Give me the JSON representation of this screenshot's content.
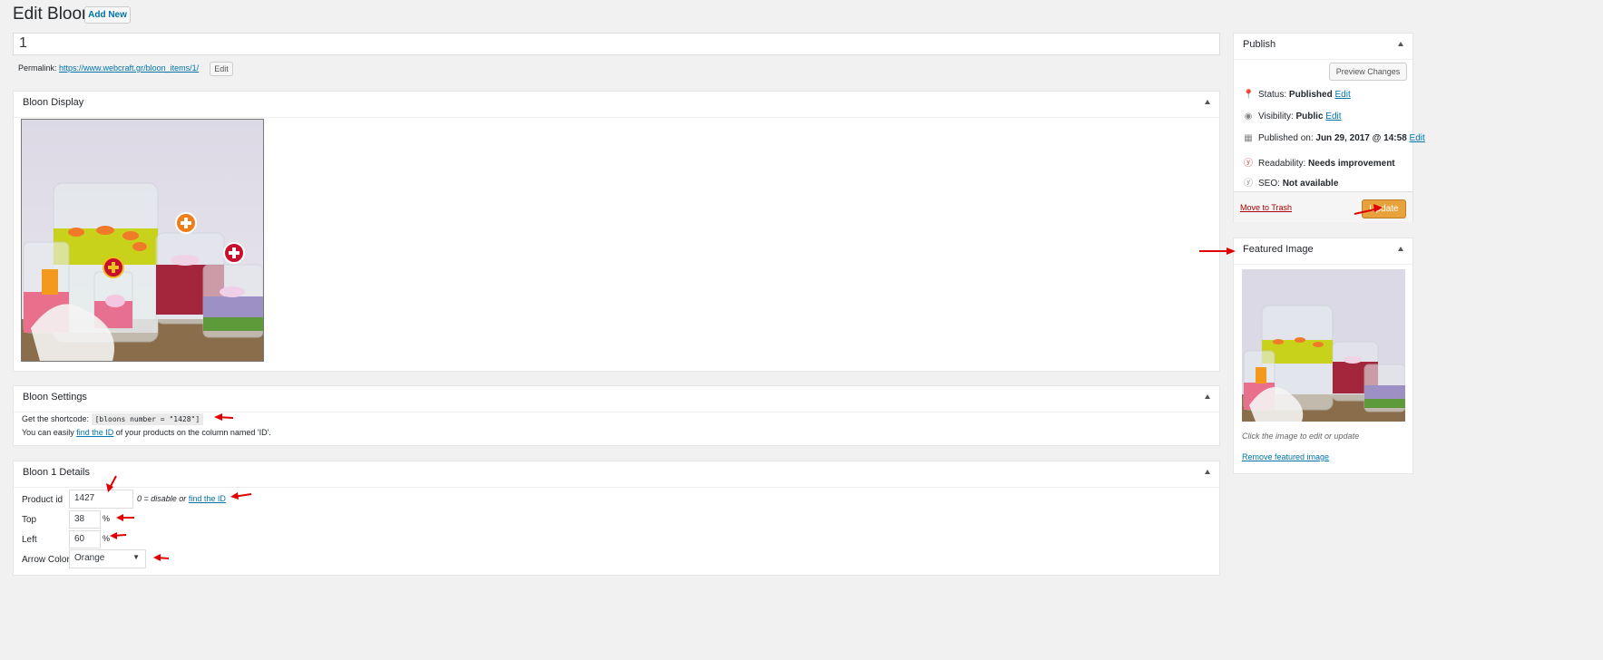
{
  "page": {
    "title": "Edit Bloon",
    "add_new": "Add New"
  },
  "post_title_value": "1",
  "permalink": {
    "label": "Permalink:",
    "url": "https://www.webcraft.gr/bloon_items/1/",
    "edit": "Edit"
  },
  "display_box": {
    "title": "Bloon Display"
  },
  "settings_box": {
    "title": "Bloon Settings",
    "shortcode_label": "Get the shortcode:",
    "shortcode": "[bloons number = \"1428\"]",
    "help_pre": "You can easily",
    "help_link": "find the ID",
    "help_post": "of your products on the column named 'ID'."
  },
  "details_box": {
    "title": "Bloon 1 Details",
    "product_id_label": "Product id",
    "product_id_value": "1427",
    "product_hint_pre": "0 = disable or",
    "product_hint_link": "find the ID",
    "top_label": "Top",
    "top_value": "38",
    "left_label": "Left",
    "left_value": "60",
    "percent": "%",
    "arrow_color_label": "Arrow Color",
    "arrow_color_value": "Orange"
  },
  "publish_box": {
    "title": "Publish",
    "preview": "Preview Changes",
    "status_label": "Status:",
    "status_value": "Published",
    "visibility_label": "Visibility:",
    "visibility_value": "Public",
    "published_label": "Published on:",
    "published_value": "Jun 29, 2017 @ 14:58",
    "readability_label": "Readability:",
    "readability_value": "Needs improvement",
    "seo_label": "SEO:",
    "seo_value": "Not available",
    "edit": "Edit",
    "trash": "Move to Trash",
    "update": "Update"
  },
  "featured_box": {
    "title": "Featured Image",
    "caption": "Click the image to edit or update",
    "remove": "Remove featured image"
  },
  "colors": {
    "accent_orange": "#e8a23c",
    "link": "#0073aa",
    "trash_red": "#a00",
    "annotation_red": "#e00000",
    "hotspot_orange": "#f07d1a",
    "hotspot_red": "#c8102e"
  },
  "icons": [
    "pin-icon",
    "eye-icon",
    "calendar-icon",
    "yoast-icon",
    "plus-hotspot-icon",
    "chevron-down-icon"
  ]
}
